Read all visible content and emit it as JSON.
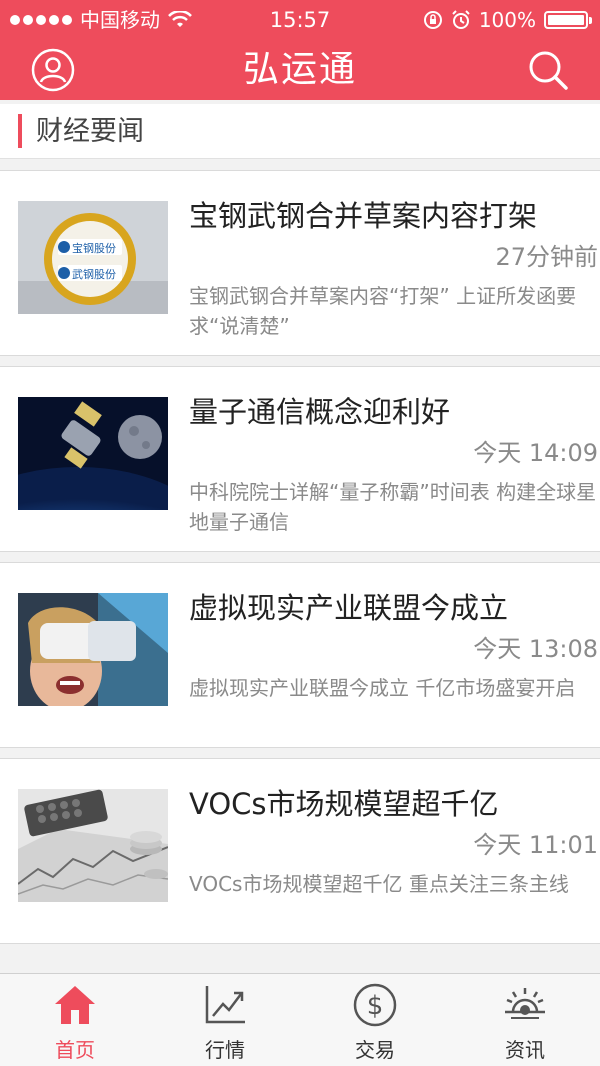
{
  "status_bar": {
    "carrier": "中国移动",
    "time": "15:57",
    "battery": "100%"
  },
  "nav": {
    "title": "弘运通",
    "left_icon": "user-icon",
    "right_icon": "search-icon"
  },
  "section": {
    "title": "财经要闻"
  },
  "news": [
    {
      "title": "宝钢武钢合并草案内容打架",
      "time": "27分钟前",
      "summary": "宝钢武钢合并草案内容“打架” 上证所发函要求“说清楚”"
    },
    {
      "title": "量子通信概念迎利好",
      "time": "今天 14:09",
      "summary": "中科院院士详解“量子称霸”时间表 构建全球星地量子通信"
    },
    {
      "title": "虚拟现实产业联盟今成立",
      "time": "今天 13:08",
      "summary": "虚拟现实产业联盟今成立 千亿市场盛宴开启"
    },
    {
      "title": "VOCs市场规模望超千亿",
      "time": "今天 11:01",
      "summary": "VOCs市场规模望超千亿 重点关注三条主线"
    }
  ],
  "thumb_text": {
    "logo1": "宝钢股份",
    "logo2": "武钢股份"
  },
  "tabs": [
    {
      "label": "首页",
      "icon": "home-icon",
      "active": true
    },
    {
      "label": "行情",
      "icon": "chart-icon",
      "active": false
    },
    {
      "label": "交易",
      "icon": "dollar-icon",
      "active": false
    },
    {
      "label": "资讯",
      "icon": "news-icon",
      "active": false
    }
  ],
  "colors": {
    "brand": "#ee4c5c",
    "text_secondary": "#8a8a8a"
  }
}
